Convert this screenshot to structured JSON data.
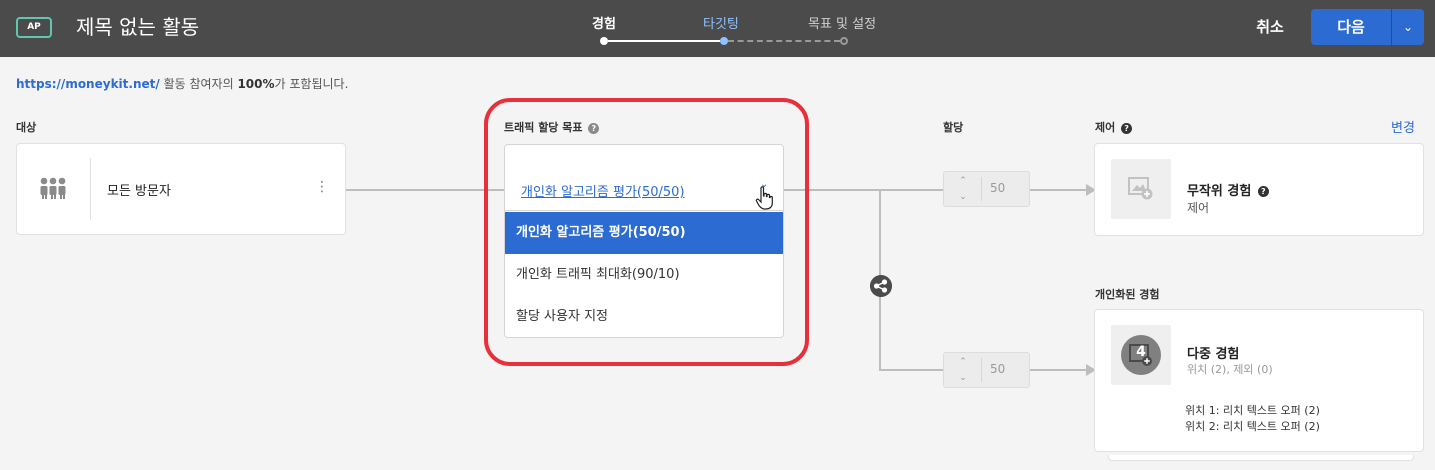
{
  "header": {
    "badge": "AP",
    "title": "제목 없는 활동",
    "steps": [
      {
        "label": "경험",
        "state": "done"
      },
      {
        "label": "타깃팅",
        "state": "active"
      },
      {
        "label": "목표 및 설정",
        "state": "pending"
      }
    ],
    "cancel_label": "취소",
    "next_label": "다음"
  },
  "info": {
    "url": "https://moneykit.net/",
    "text_before": " 활동 참여자의 ",
    "percent": "100%",
    "text_after": "가 포함됩니다."
  },
  "audience": {
    "section_label": "대상",
    "name": "모든 방문자"
  },
  "traffic_goal": {
    "section_label": "트래픽 할당 목표",
    "selected_value": "개인화 알고리즘 평가(50/50)",
    "options": [
      {
        "label": "개인화 알고리즘 평가(50/50)",
        "selected": true
      },
      {
        "label": "개인화 트래픽 최대화(90/10)",
        "selected": false
      },
      {
        "label": "할당 사용자 지정",
        "selected": false
      }
    ]
  },
  "allocation": {
    "section_label": "할당",
    "control_value": "50",
    "personalized_value": "50"
  },
  "control": {
    "section_label": "제어",
    "change_label": "변경",
    "title": "무작위 경험",
    "subtitle": "제어"
  },
  "personalized": {
    "section_label": "개인화된 경험",
    "badge_count": "4",
    "title": "다중 경험",
    "subtitle": "위치 (2), 제외 (0)",
    "locations": [
      {
        "label": "위치 1:",
        "value": "리치 텍스트 오퍼 (2)"
      },
      {
        "label": "위치 2:",
        "value": "리치 텍스트 오퍼 (2)"
      }
    ]
  },
  "colors": {
    "topbar": "#4b4b4b",
    "accent": "#2c6bd1",
    "highlight": "#e8303a",
    "badge_border": "#5fc6b0"
  }
}
